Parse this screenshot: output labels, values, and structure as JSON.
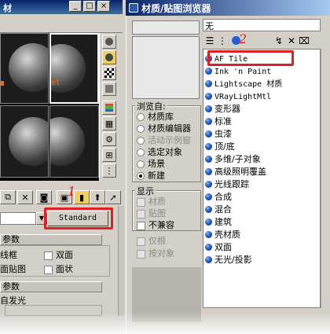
{
  "left": {
    "title": "材",
    "win_buttons": [
      "_",
      "□",
      "×"
    ],
    "slot_hint": "et",
    "std_button": "Standard",
    "callout_1": "1",
    "rollout_params": "参数",
    "row1": {
      "a": "线框",
      "b": "双面"
    },
    "row2": {
      "a": "面贴图",
      "b": "面状"
    },
    "rollout_params2": "参数",
    "row3": "自发光"
  },
  "browser": {
    "title": "材质/贴图浏览器",
    "path_value": "无",
    "callout_2": "2",
    "browse_from": {
      "label": "浏览自:",
      "options": [
        {
          "label": "材质库",
          "selected": false,
          "disabled": false
        },
        {
          "label": "材质编辑器",
          "selected": false,
          "disabled": false
        },
        {
          "label": "活动示例窗",
          "selected": false,
          "disabled": true
        },
        {
          "label": "选定对象",
          "selected": false,
          "disabled": false
        },
        {
          "label": "场景",
          "selected": false,
          "disabled": false
        },
        {
          "label": "新建",
          "selected": true,
          "disabled": false
        }
      ]
    },
    "show": {
      "label": "显示",
      "options": [
        {
          "label": "材质",
          "disabled": true
        },
        {
          "label": "贴图",
          "disabled": true
        },
        {
          "label": "不兼容",
          "disabled": false
        }
      ]
    },
    "extra": [
      {
        "label": "仅根",
        "disabled": true
      },
      {
        "label": "按对象",
        "disabled": true
      }
    ],
    "materials": [
      "AF Tile",
      "Ink 'n Paint",
      "Lightscape 材质",
      "VRayLightMtl",
      "变形器",
      "标准",
      "虫漆",
      "顶/底",
      "多维/子对象",
      "高级照明覆盖",
      "光线跟踪",
      "合成",
      "混合",
      "建筑",
      "壳材质",
      "双面",
      "无光/投影"
    ]
  },
  "colors": {
    "highlight_red": "#e02020",
    "titlebar": "#0a246a",
    "material_ball": "#2060d0"
  }
}
